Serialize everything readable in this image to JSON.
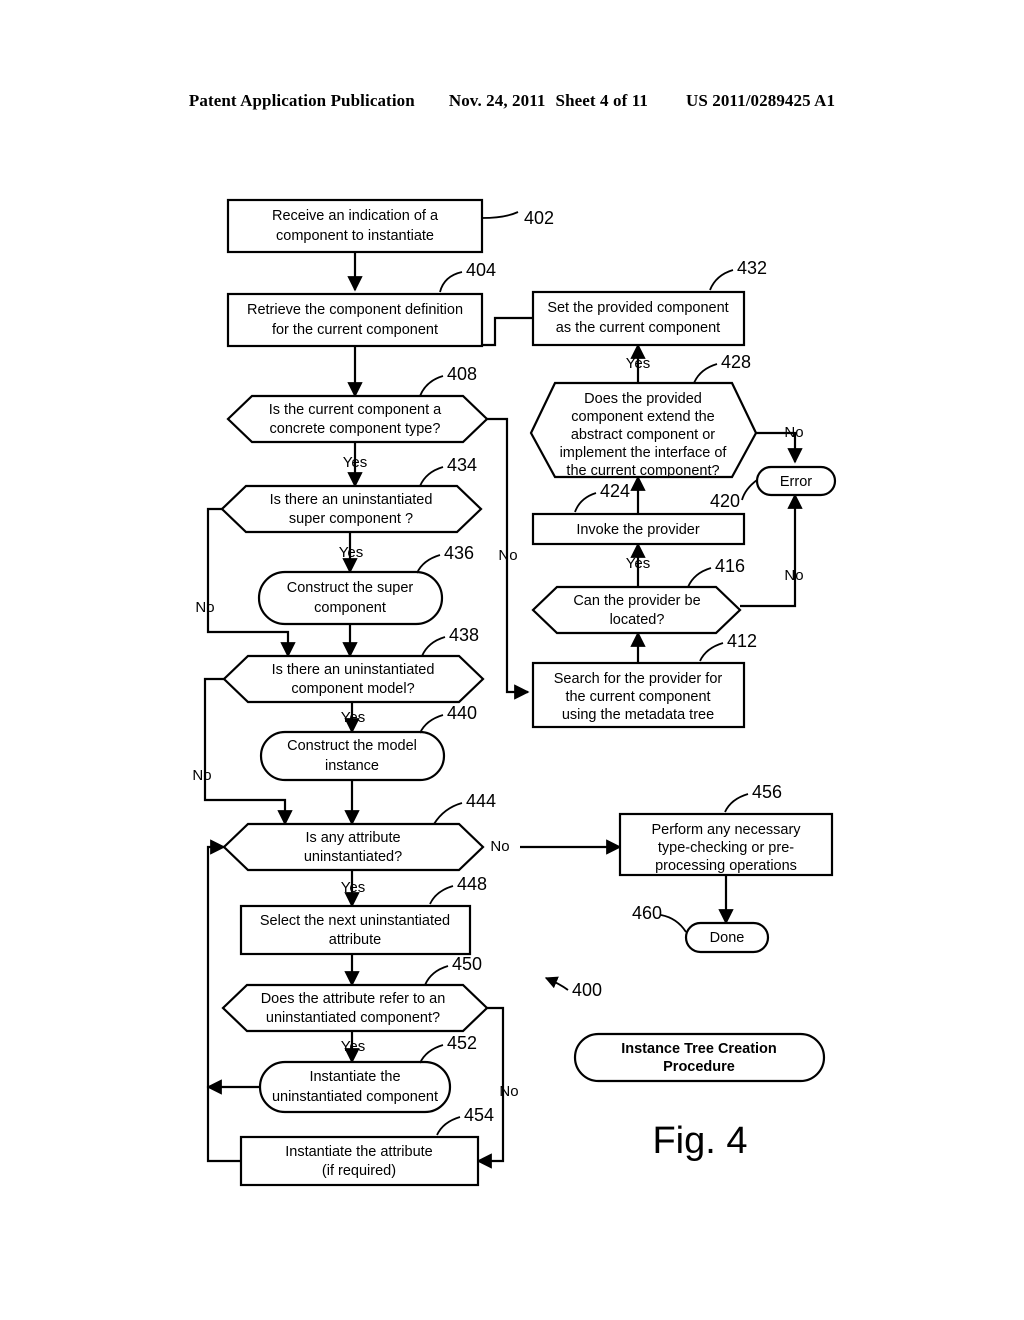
{
  "header": {
    "publication": "Patent Application Publication",
    "date": "Nov. 24, 2011",
    "sheet": "Sheet 4 of 11",
    "number": "US 2011/0289425 A1"
  },
  "figure": {
    "caption": "Fig. 4",
    "procedure_label": "Instance Tree Creation Procedure",
    "diagram_ref": "400"
  },
  "chart_data": {
    "type": "diagram",
    "title": "Instance Tree Creation Procedure",
    "nodes": [
      {
        "ref": "402",
        "shape": "process",
        "text": "Receive an indication of a component to instantiate"
      },
      {
        "ref": "404",
        "shape": "process",
        "text": "Retrieve the component definition for the current component"
      },
      {
        "ref": "408",
        "shape": "decision",
        "text": "Is the current component a concrete component type?"
      },
      {
        "ref": "412",
        "shape": "process",
        "text": "Search for the provider for the current component using the metadata tree"
      },
      {
        "ref": "416",
        "shape": "decision",
        "text": "Can the provider be located?"
      },
      {
        "ref": "420",
        "shape": "terminal",
        "text": "Error"
      },
      {
        "ref": "424",
        "shape": "process",
        "text": "Invoke the provider"
      },
      {
        "ref": "428",
        "shape": "decision",
        "text": "Does the provided component extend the abstract component or implement the interface of the current component?"
      },
      {
        "ref": "432",
        "shape": "process",
        "text": "Set the provided component as the current component"
      },
      {
        "ref": "434",
        "shape": "decision",
        "text": "Is there an uninstantiated super component ?"
      },
      {
        "ref": "436",
        "shape": "stadium",
        "text": "Construct the super component"
      },
      {
        "ref": "438",
        "shape": "decision",
        "text": "Is there an uninstantiated component model?"
      },
      {
        "ref": "440",
        "shape": "stadium",
        "text": "Construct the model instance"
      },
      {
        "ref": "444",
        "shape": "decision",
        "text": "Is any attribute uninstantiated?"
      },
      {
        "ref": "448",
        "shape": "process",
        "text": "Select the next uninstantiated attribute"
      },
      {
        "ref": "450",
        "shape": "decision",
        "text": "Does the attribute refer to an uninstantiated component?"
      },
      {
        "ref": "452",
        "shape": "stadium",
        "text": "Instantiate the uninstantiated component"
      },
      {
        "ref": "454",
        "shape": "process",
        "text": "Instantiate the  attribute (if required)"
      },
      {
        "ref": "456",
        "shape": "process",
        "text": "Perform any necessary type-checking or pre-processing operations"
      },
      {
        "ref": "460",
        "shape": "terminal",
        "text": "Done"
      }
    ],
    "edges": [
      {
        "from": "402",
        "to": "404",
        "label": ""
      },
      {
        "from": "404",
        "to": "408",
        "label": ""
      },
      {
        "from": "408",
        "to": "434",
        "label": "Yes"
      },
      {
        "from": "408",
        "to": "412",
        "label": "No"
      },
      {
        "from": "412",
        "to": "416",
        "label": ""
      },
      {
        "from": "416",
        "to": "424",
        "label": "Yes"
      },
      {
        "from": "416",
        "to": "420",
        "label": "No"
      },
      {
        "from": "424",
        "to": "428",
        "label": ""
      },
      {
        "from": "428",
        "to": "432",
        "label": "Yes"
      },
      {
        "from": "428",
        "to": "420",
        "label": "No"
      },
      {
        "from": "432",
        "to": "408",
        "label": ""
      },
      {
        "from": "434",
        "to": "436",
        "label": "Yes"
      },
      {
        "from": "434",
        "to": "438",
        "label": "No"
      },
      {
        "from": "436",
        "to": "438",
        "label": ""
      },
      {
        "from": "438",
        "to": "440",
        "label": "Yes"
      },
      {
        "from": "438",
        "to": "444",
        "label": "No"
      },
      {
        "from": "440",
        "to": "444",
        "label": ""
      },
      {
        "from": "444",
        "to": "448",
        "label": "Yes"
      },
      {
        "from": "444",
        "to": "456",
        "label": "No"
      },
      {
        "from": "448",
        "to": "450",
        "label": ""
      },
      {
        "from": "450",
        "to": "452",
        "label": "Yes"
      },
      {
        "from": "450",
        "to": "454",
        "label": "No"
      },
      {
        "from": "452",
        "to": "444",
        "label": ""
      },
      {
        "from": "454",
        "to": "444",
        "label": ""
      },
      {
        "from": "456",
        "to": "460",
        "label": ""
      }
    ],
    "node_text_lines": {
      "n402": [
        "Receive an indication of a",
        "component to instantiate"
      ],
      "n404": [
        "Retrieve the component definition",
        "for the current component"
      ],
      "n408": [
        "Is the current component a",
        "concrete component type?"
      ],
      "n412": [
        "Search for the provider for",
        "the current component",
        "using the metadata tree"
      ],
      "n416": [
        "Can the provider be",
        "located?"
      ],
      "n420": [
        "Error"
      ],
      "n424": [
        "Invoke the provider"
      ],
      "n428": [
        "Does the provided",
        "component extend the",
        "abstract component or",
        "implement the interface of",
        "the current component?"
      ],
      "n432": [
        "Set the provided component",
        "as the current component"
      ],
      "n434": [
        "Is there an uninstantiated",
        "super component ?"
      ],
      "n436": [
        "Construct the super",
        "component"
      ],
      "n438": [
        "Is there an uninstantiated",
        "component model?"
      ],
      "n440": [
        "Construct the model",
        "instance"
      ],
      "n444": [
        "Is any attribute",
        "uninstantiated?"
      ],
      "n448": [
        "Select the next uninstantiated",
        "attribute"
      ],
      "n450": [
        "Does the attribute refer to an",
        "uninstantiated component?"
      ],
      "n452": [
        "Instantiate the",
        "uninstantiated component"
      ],
      "n454": [
        "Instantiate the  attribute",
        "(if required)"
      ],
      "n456": [
        "Perform any necessary",
        "type-checking or pre-",
        "processing operations"
      ],
      "n460": [
        "Done"
      ],
      "proc": [
        "Instance Tree Creation",
        "Procedure"
      ]
    },
    "edge_labels": {
      "l408_yes": "Yes",
      "l408_no": "No",
      "l416_yes": "Yes",
      "l416_no": "No",
      "l428_yes": "Yes",
      "l428_no": "No",
      "l434_yes": "Yes",
      "l434_no": "No",
      "l438_yes": "Yes",
      "l438_no": "No",
      "l444_yes": "Yes",
      "l444_no": "No",
      "l450_yes": "Yes",
      "l450_no": "No"
    },
    "ref_labels": {
      "r402": "402",
      "r404": "404",
      "r408": "408",
      "r412": "412",
      "r416": "416",
      "r420": "420",
      "r424": "424",
      "r428": "428",
      "r432": "432",
      "r434": "434",
      "r436": "436",
      "r438": "438",
      "r440": "440",
      "r444": "444",
      "r448": "448",
      "r450": "450",
      "r452": "452",
      "r454": "454",
      "r456": "456",
      "r460": "460",
      "r400": "400"
    }
  }
}
